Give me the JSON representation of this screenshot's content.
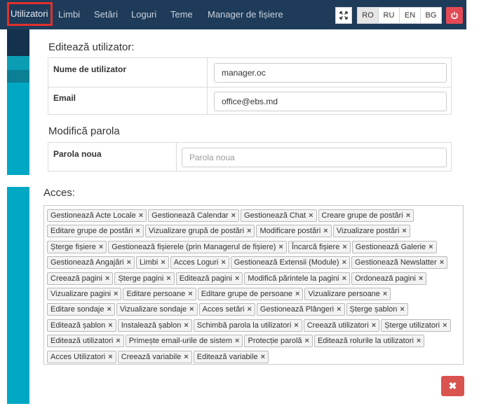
{
  "nav": {
    "items": [
      "Utilizatori",
      "Limbi",
      "Setări",
      "Loguri",
      "Teme",
      "Manager de fișiere"
    ],
    "fullscreen_icon": "fullscreen-icon",
    "languages": [
      "RO",
      "RU",
      "EN",
      "BG"
    ],
    "active_language": "RO",
    "power_icon": "power-icon",
    "navbar_color": "#1e3b59",
    "accent_color": "#e0312a"
  },
  "edit_user": {
    "title": "Editează utilizator:",
    "username_label": "Nume de utilizator",
    "username_value": "manager.oc",
    "email_label": "Email",
    "email_value": "office@ebs.md"
  },
  "password": {
    "title": "Modifică parola",
    "new_password_label": "Parola noua",
    "new_password_placeholder": "Parola noua"
  },
  "access": {
    "title": "Acces:",
    "remove_glyph": "×",
    "rows": [
      [
        "Gestionează Acte Locale",
        "Gestionează Calendar",
        "Gestionează Chat",
        "Creare grupe de postări"
      ],
      [
        "Editare grupe de postări",
        "Vizualizare grupă de postări",
        "Modificare postări",
        "Vizualizare postări"
      ],
      [
        "Șterge fișiere",
        "Gestionează fișierele (prin Managerul de fișiere)",
        "Încarcă fișiere",
        "Gestionează Galerie"
      ],
      [
        "Gestionează Angajări",
        "Limbi",
        "Acces Loguri",
        "Gestionează Extensii (Module)",
        "Gestionează Newslatter"
      ],
      [
        "Creează pagini",
        "Șterge pagini",
        "Editează pagini",
        "Modifică părintele la pagini",
        "Ordonează pagini"
      ],
      [
        "Vizualizare pagini",
        "Editare persoane",
        "Editare grupe de persoane",
        "Vizualizare persoane"
      ],
      [
        "Editare sondaje",
        "Vizualizare sondaje",
        "Acces setări",
        "Gestionează Plângeri",
        "Șterge șablon"
      ],
      [
        "Editează șablon",
        "Instalează șablon",
        "Schimbă parola la utilizatori",
        "Creează utilizatori",
        "Șterge utilizatori"
      ],
      [
        "Editează utilizatori",
        "Primește email-urile de sistem",
        "Protecție parolă",
        "Editează rolurile la utilizatori"
      ],
      [
        "Acces Utilizatori",
        "Creează variabile",
        "Editează variabile"
      ]
    ]
  },
  "delete_button": {
    "icon": "close-icon",
    "glyph": "✖",
    "color": "#d9534f"
  }
}
